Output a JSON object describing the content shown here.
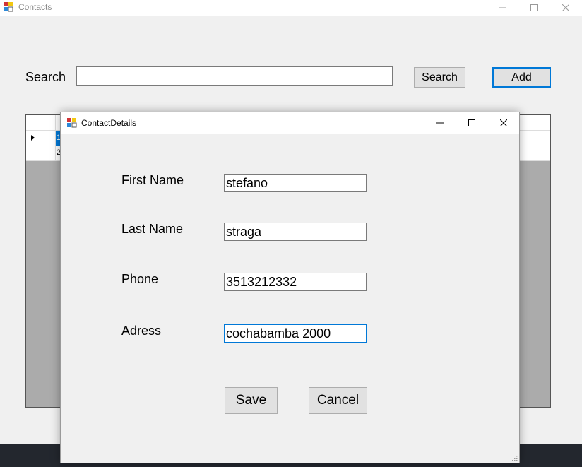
{
  "main_window": {
    "title": "Contacts",
    "search_label": "Search",
    "search_value": "",
    "search_button": "Search",
    "add_button": "Add",
    "grid": {
      "rows": [
        {
          "selected": true,
          "first_cell": "1"
        },
        {
          "selected": false,
          "first_cell": "2"
        }
      ]
    }
  },
  "dialog": {
    "title": "ContactDetails",
    "fields": [
      {
        "label": "First Name",
        "value": "stefano"
      },
      {
        "label": "Last Name",
        "value": "straga"
      },
      {
        "label": "Phone",
        "value": "3513212332"
      },
      {
        "label": "Adress",
        "value": "cochabamba 2000"
      }
    ],
    "save_button": "Save",
    "cancel_button": "Cancel"
  },
  "colors": {
    "accent": "#0078d7",
    "window_bg": "#f0f0f0",
    "grid_bg": "#ababab",
    "taskbar": "#23272e"
  },
  "icons": [
    "app-icon",
    "minimize-icon",
    "maximize-icon",
    "close-icon",
    "row-pointer-icon",
    "resize-grip-icon"
  ]
}
